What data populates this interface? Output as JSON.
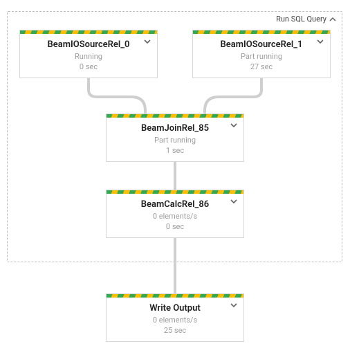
{
  "group": {
    "label": "Run SQL Query"
  },
  "nodes": {
    "src0": {
      "title": "BeamIOSourceRel_0",
      "status": "Running",
      "time": "0 sec"
    },
    "src1": {
      "title": "BeamIOSourceRel_1",
      "status": "Part running",
      "time": "27 sec"
    },
    "join": {
      "title": "BeamJoinRel_85",
      "status": "Part running",
      "time": "1 sec"
    },
    "calc": {
      "title": "BeamCalcRel_86",
      "rate": "0 elements/s",
      "time": "0 sec"
    },
    "out": {
      "title": "Write Output",
      "rate": "0 elements/s",
      "time": "25 sec"
    }
  },
  "icons": {
    "chevron_down": "chevron-down",
    "chevron_up": "chevron-up"
  }
}
